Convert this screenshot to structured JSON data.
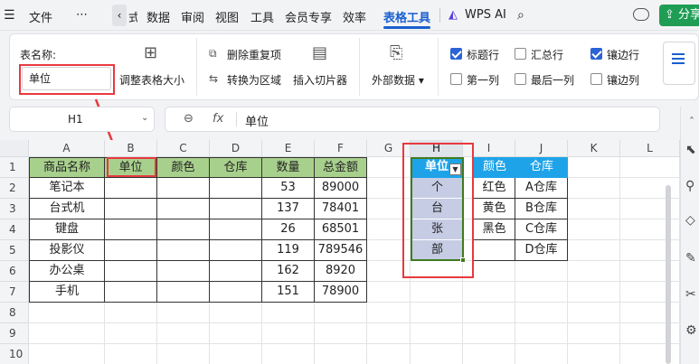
{
  "menu": {
    "file": "文件",
    "more": "⋯",
    "data": "数据",
    "review": "审阅",
    "view": "视图",
    "tools": "工具",
    "vip": "会员专享",
    "efficiency": "效率",
    "table_tools": "表格工具",
    "wps_ai": "WPS AI",
    "share": "分享"
  },
  "ribbon": {
    "table_name_label": "表名称:",
    "table_name_value": "单位",
    "resize": "调整表格大小",
    "remove_dup": "删除重复项",
    "convert_range": "转换为区域",
    "insert_slicer": "插入切片器",
    "external_data": "外部数据",
    "opts": [
      {
        "label": "标题行",
        "checked": true
      },
      {
        "label": "汇总行",
        "checked": false
      },
      {
        "label": "镶边行",
        "checked": true
      },
      {
        "label": "第一列",
        "checked": false
      },
      {
        "label": "最后一列",
        "checked": false
      },
      {
        "label": "镶边列",
        "checked": false
      }
    ]
  },
  "formula": {
    "cell_ref": "H1",
    "fx": "fx",
    "content": "单位"
  },
  "columns": [
    "A",
    "B",
    "C",
    "D",
    "E",
    "F",
    "G",
    "H",
    "I",
    "J",
    "K",
    "L"
  ],
  "rows": [
    "1",
    "2",
    "3",
    "4",
    "5",
    "6",
    "7",
    "8",
    "9",
    "10"
  ],
  "headers": {
    "A": "商品名称",
    "B": "单位",
    "C": "颜色",
    "D": "仓库",
    "E": "数量",
    "F": "总金额"
  },
  "products": [
    {
      "name": "笔记本",
      "qty": "53",
      "amount": "89000"
    },
    {
      "name": "台式机",
      "qty": "137",
      "amount": "78401"
    },
    {
      "name": "键盘",
      "qty": "26",
      "amount": "68501"
    },
    {
      "name": "投影仪",
      "qty": "119",
      "amount": "789546"
    },
    {
      "name": "办公桌",
      "qty": "162",
      "amount": "8920"
    },
    {
      "name": "手机",
      "qty": "151",
      "amount": "78900"
    }
  ],
  "side": {
    "unit_header": "单位",
    "units": [
      "个",
      "台",
      "张",
      "部"
    ],
    "color_header": "颜色",
    "colors": [
      "红色",
      "黄色",
      "黑色"
    ],
    "wh_header": "仓库",
    "warehouses": [
      "A仓库",
      "B仓库",
      "C仓库",
      "D仓库"
    ]
  },
  "colors": {
    "table_header": "#1fa3e8",
    "unit_fill": "#c6cce4",
    "green_header": "#a8d08d",
    "red": "#e8393f",
    "dark_green": "#3f7b1e",
    "active_tab": "#1a5fcf"
  }
}
